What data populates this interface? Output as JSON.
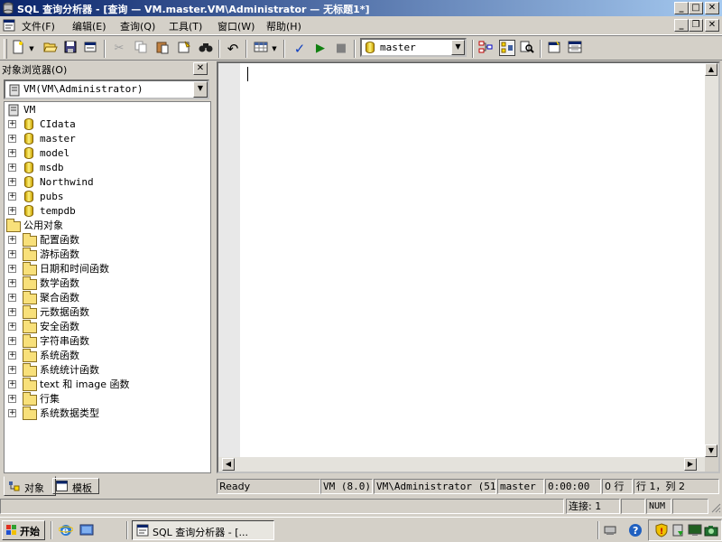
{
  "window": {
    "title": "SQL 查询分析器 - [查询 — VM.master.VM\\Administrator — 无标题1*]",
    "min_glyph": "_",
    "max_glyph": "□",
    "close_glyph": "✕"
  },
  "menu": {
    "items": [
      "文件(F)",
      "编辑(E)",
      "查询(Q)",
      "工具(T)",
      "窗口(W)",
      "帮助(H)"
    ]
  },
  "toolbar": {
    "database_selected": "master"
  },
  "object_browser": {
    "title": "对象浏览器(O)",
    "server_selector": "VM(VM\\Administrator)",
    "tree": {
      "root": "VM",
      "databases": [
        "CIdata",
        "master",
        "model",
        "msdb",
        "Northwind",
        "pubs",
        "tempdb"
      ],
      "common_objects": "公用对象",
      "folders": [
        "配置函数",
        "游标函数",
        "日期和时间函数",
        "数学函数",
        "聚合函数",
        "元数据函数",
        "安全函数",
        "字符串函数",
        "系统函数",
        "系统统计函数",
        "text 和 image 函数",
        "行集",
        "系统数据类型"
      ]
    },
    "tabs": [
      "对象",
      "模板"
    ]
  },
  "status": {
    "ready": "Ready",
    "server": "VM (8.0)",
    "user": "VM\\Administrator (51)",
    "database": "master",
    "elapsed": "0:00:00",
    "rows": "0 行",
    "position": "行 1，列 2",
    "connections": "连接: 1",
    "num": "NUM"
  },
  "taskbar": {
    "start_label": "开始",
    "task_label": "SQL 查询分析器 - [..."
  },
  "colors": {
    "title_start": "#0a246a",
    "title_end": "#a6caf0",
    "face": "#d4d0c8"
  }
}
